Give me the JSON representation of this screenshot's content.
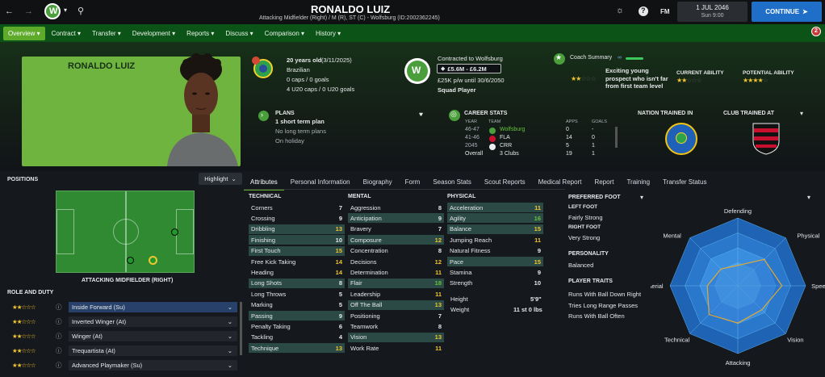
{
  "topbar": {
    "player_name": "RONALDO LUIZ",
    "subtitle": "Attacking Midfielder (Right) / M (R), ST (C) - Wolfsburg (ID:2002362245)",
    "fm_label": "FM",
    "date": "1 JUL 2046",
    "day": "Sun 9:00",
    "continue_label": "CONTINUE"
  },
  "nav": {
    "tabs": [
      "Overview",
      "Contract",
      "Transfer",
      "Development",
      "Reports",
      "Discuss",
      "Comparison",
      "History"
    ],
    "notification_count": "2"
  },
  "card": {
    "name": "RONALDO LUIZ"
  },
  "info": {
    "age": "20 years old",
    "dob": "(3/11/2025)",
    "nationality": "Brazilian",
    "caps": "0 caps / 0 goals",
    "u20_caps": "4 U20 caps / 0 U20 goals",
    "contract_label": "Contracted to Wolfsburg",
    "value": "£5.6M - £6.2M",
    "wage": "£25K p/w until 30/6/2050",
    "squad_status": "Squad Player",
    "coach_summary_label": "Coach Summary",
    "coach_summary": "Exciting young prospect who isn't far from first team level",
    "current_ability_label": "CURRENT ABILITY",
    "potential_ability_label": "POTENTIAL ABILITY"
  },
  "plans": {
    "title": "PLANS",
    "short_term": "1 short term plan",
    "long_term": "No long term plans",
    "holiday": "On holiday"
  },
  "career": {
    "title": "CAREER STATS",
    "headers": [
      "YEAR",
      "TEAM",
      "APPS",
      "GOALS"
    ],
    "rows": [
      {
        "year": "46-47",
        "team": "Wolfsburg",
        "apps": "0",
        "goals": "-"
      },
      {
        "year": "41-46",
        "team": "FLA",
        "apps": "14",
        "goals": "0"
      },
      {
        "year": "2045",
        "team": "CRR",
        "apps": "5",
        "goals": "1"
      },
      {
        "year": "Overall",
        "team": "3 Clubs",
        "apps": "19",
        "goals": "1"
      }
    ]
  },
  "trained": {
    "nation_label": "NATION TRAINED IN",
    "club_label": "CLUB TRAINED AT"
  },
  "positions": {
    "title": "POSITIONS",
    "highlight_label": "Highlight",
    "position_label": "ATTACKING MIDFIELDER (RIGHT)",
    "role_title": "ROLE AND DUTY",
    "roles": [
      {
        "name": "Inside Forward (Su)",
        "stars": "★★☆☆☆"
      },
      {
        "name": "Inverted Winger (At)",
        "stars": "★★☆☆☆"
      },
      {
        "name": "Winger (At)",
        "stars": "★★☆☆☆"
      },
      {
        "name": "Trequartista (At)",
        "stars": "★★☆☆☆"
      },
      {
        "name": "Advanced Playmaker (Su)",
        "stars": "★★☆☆☆"
      }
    ]
  },
  "attr_tabs": [
    "Attributes",
    "Personal Information",
    "Biography",
    "Form",
    "Season Stats",
    "Scout Reports",
    "Medical Report",
    "Report",
    "Training",
    "Transfer Status"
  ],
  "technical": {
    "title": "TECHNICAL",
    "rows": [
      {
        "name": "Corners",
        "value": "7",
        "hl": false
      },
      {
        "name": "Crossing",
        "value": "9",
        "hl": false
      },
      {
        "name": "Dribbling",
        "value": "13",
        "hl": true
      },
      {
        "name": "Finishing",
        "value": "10",
        "hl": true
      },
      {
        "name": "First Touch",
        "value": "15",
        "hl": true
      },
      {
        "name": "Free Kick Taking",
        "value": "14",
        "hl": false
      },
      {
        "name": "Heading",
        "value": "14",
        "hl": false
      },
      {
        "name": "Long Shots",
        "value": "8",
        "hl": true
      },
      {
        "name": "Long Throws",
        "value": "5",
        "hl": false
      },
      {
        "name": "Marking",
        "value": "5",
        "hl": false
      },
      {
        "name": "Passing",
        "value": "9",
        "hl": true
      },
      {
        "name": "Penalty Taking",
        "value": "6",
        "hl": false
      },
      {
        "name": "Tackling",
        "value": "4",
        "hl": false
      },
      {
        "name": "Technique",
        "value": "13",
        "hl": true
      }
    ]
  },
  "mental": {
    "title": "MENTAL",
    "rows": [
      {
        "name": "Aggression",
        "value": "8",
        "hl": false
      },
      {
        "name": "Anticipation",
        "value": "9",
        "hl": true
      },
      {
        "name": "Bravery",
        "value": "7",
        "hl": false
      },
      {
        "name": "Composure",
        "value": "12",
        "hl": true
      },
      {
        "name": "Concentration",
        "value": "8",
        "hl": false
      },
      {
        "name": "Decisions",
        "value": "12",
        "hl": false
      },
      {
        "name": "Determination",
        "value": "11",
        "hl": false
      },
      {
        "name": "Flair",
        "value": "18",
        "hl": true
      },
      {
        "name": "Leadership",
        "value": "11",
        "hl": false
      },
      {
        "name": "Off The Ball",
        "value": "13",
        "hl": true
      },
      {
        "name": "Positioning",
        "value": "7",
        "hl": false
      },
      {
        "name": "Teamwork",
        "value": "8",
        "hl": false
      },
      {
        "name": "Vision",
        "value": "13",
        "hl": true
      },
      {
        "name": "Work Rate",
        "value": "11",
        "hl": false
      }
    ]
  },
  "physical": {
    "title": "PHYSICAL",
    "rows": [
      {
        "name": "Acceleration",
        "value": "11",
        "hl": true
      },
      {
        "name": "Agility",
        "value": "16",
        "hl": true
      },
      {
        "name": "Balance",
        "value": "15",
        "hl": true
      },
      {
        "name": "Jumping Reach",
        "value": "11",
        "hl": false
      },
      {
        "name": "Natural Fitness",
        "value": "9",
        "hl": false
      },
      {
        "name": "Pace",
        "value": "15",
        "hl": true
      },
      {
        "name": "Stamina",
        "value": "9",
        "hl": false
      },
      {
        "name": "Strength",
        "value": "10",
        "hl": false
      }
    ],
    "height_label": "Height",
    "height": "5'9\"",
    "weight_label": "Weight",
    "weight": "11 st 0 lbs"
  },
  "profile": {
    "preferred_foot_title": "PREFERRED FOOT",
    "left_foot_label": "LEFT FOOT",
    "left_foot": "Fairly Strong",
    "right_foot_label": "RIGHT FOOT",
    "right_foot": "Very Strong",
    "personality_title": "PERSONALITY",
    "personality": "Balanced",
    "traits_title": "PLAYER TRAITS",
    "traits": [
      "Runs With Ball Down Right",
      "Tries Long Range Passes",
      "Runs With Ball Often"
    ]
  },
  "radar": {
    "labels": [
      "Defending",
      "Physical",
      "Speed",
      "Vision",
      "Attacking",
      "Technical",
      "Aerial",
      "Mental"
    ],
    "values": [
      0.3,
      0.55,
      0.65,
      0.5,
      0.55,
      0.6,
      0.45,
      0.35
    ]
  },
  "colors": {
    "accent": "#5eaa2b",
    "highlight_row": "#2b4a45",
    "continue": "#1f6ec7"
  }
}
